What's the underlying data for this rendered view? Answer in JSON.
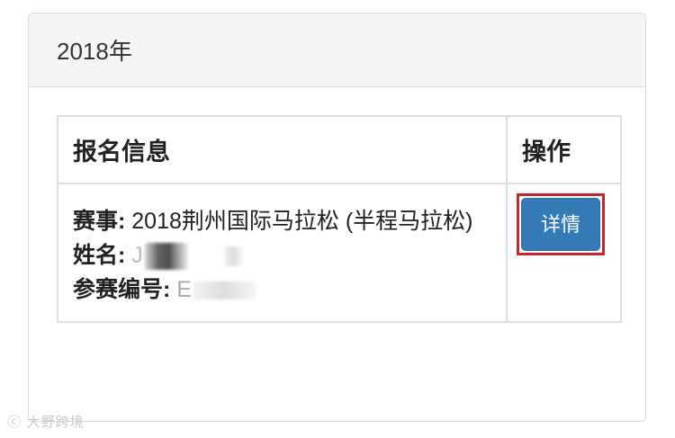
{
  "panel": {
    "heading": "2018年"
  },
  "table": {
    "headers": [
      "报名信息",
      "操作"
    ],
    "rows": [
      {
        "event_label": "赛事:",
        "event_value": "2018荆州国际马拉松 (半程马拉松)",
        "name_label": "姓名:",
        "name_value": "J",
        "bib_label": "参赛编号:",
        "bib_value": "E",
        "action_label": "详情"
      }
    ]
  },
  "watermark": {
    "text": "大野跨境"
  },
  "colors": {
    "button_bg": "#337ab7",
    "highlight_border": "#c2272d",
    "heading_bg": "#f5f5f5"
  }
}
